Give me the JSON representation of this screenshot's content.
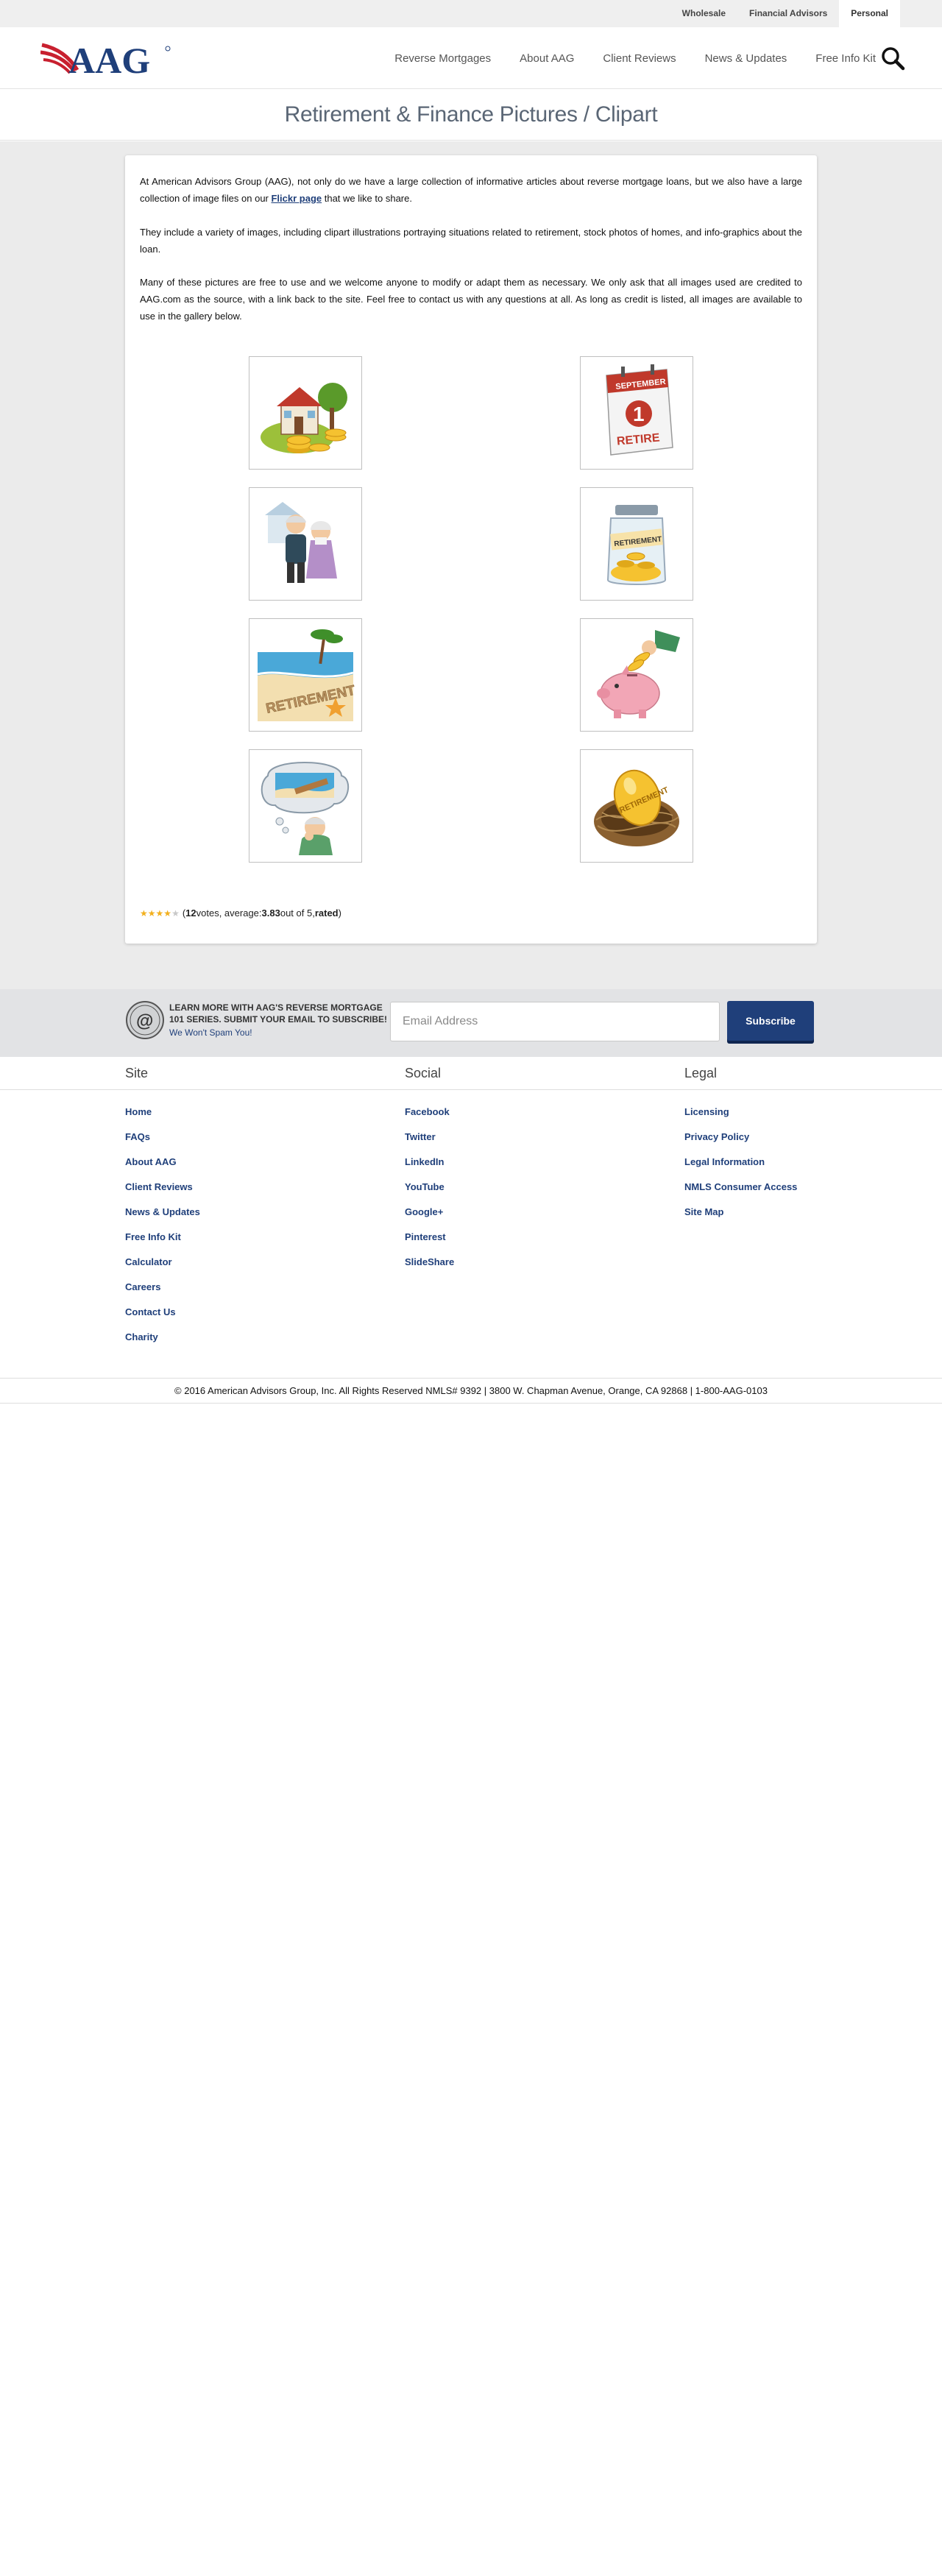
{
  "topbar": {
    "links": [
      "Wholesale",
      "Financial Advisors",
      "Personal"
    ],
    "active": "Personal"
  },
  "header": {
    "logo_text": "AAG",
    "nav": [
      "Reverse Mortgages",
      "About AAG",
      "Client Reviews",
      "News & Updates",
      "Free Info Kit"
    ],
    "search_icon": "search-icon"
  },
  "page": {
    "title": "Retirement & Finance Pictures / Clipart"
  },
  "intro": {
    "p1_before": "At American Advisors Group (AAG), not only do we have a large collection of informative articles about reverse mortgage loans, but we also have a large collection of image files on our ",
    "p1_link": "Flickr page",
    "p1_after": " that we like to share.",
    "p2": "They include a variety of images, including clipart illustrations portraying situations related to retirement, stock photos of homes, and info-graphics about the loan.",
    "p3": "Many of these pictures are free to use and we welcome anyone to modify or adapt them as necessary. We only ask that all images used are credited to AAG.com as the source, with a link back to the site. Feel free to contact us with any questions at all. As long as credit is listed, all images are available to use in the gallery below."
  },
  "gallery": {
    "calendar_month": "SEPTEMBER",
    "calendar_day": "1",
    "calendar_word": "RETIRE",
    "jar_label": "RETIREMENT",
    "sand_word": "RETIREMENT",
    "egg_word": "RETIREMENT"
  },
  "rating": {
    "votes": "12",
    "average": "3.83",
    "open": "(",
    "votes_suffix": " votes, average: ",
    "out_of": " out of 5, ",
    "rated": "rated",
    "close": ")",
    "star_color": "#f2b01e",
    "star_empty_color": "#c8c8c8"
  },
  "subscribe": {
    "title": "LEARN MORE WITH AAG'S REVERSE MORTGAGE 101 SERIES. SUBMIT YOUR EMAIL TO SUBSCRIBE!",
    "spam_note": "We Won't Spam You!",
    "placeholder": "Email Address",
    "button": "Subscribe"
  },
  "footer": {
    "site_heading": "Site",
    "site_links": [
      "Home",
      "FAQs",
      "About AAG",
      "Client Reviews",
      "News & Updates",
      "Free Info Kit",
      "Calculator",
      "Careers",
      "Contact Us",
      "Charity"
    ],
    "social_heading": "Social",
    "social_links": [
      "Facebook",
      "Twitter",
      "LinkedIn",
      "YouTube",
      "Google+",
      "Pinterest",
      "SlideShare"
    ],
    "legal_heading": "Legal",
    "legal_links": [
      "Licensing",
      "Privacy Policy",
      "Legal Information",
      "NMLS Consumer Access",
      "Site Map"
    ],
    "copyright": "© 2016 American Advisors Group, Inc. All Rights Reserved NMLS# 9392 | 3800 W. Chapman Avenue, Orange, CA 92868 | 1-800-AAG-0103"
  },
  "colors": {
    "brand_navy": "#1f3f7a",
    "brand_red": "#c8202f"
  }
}
